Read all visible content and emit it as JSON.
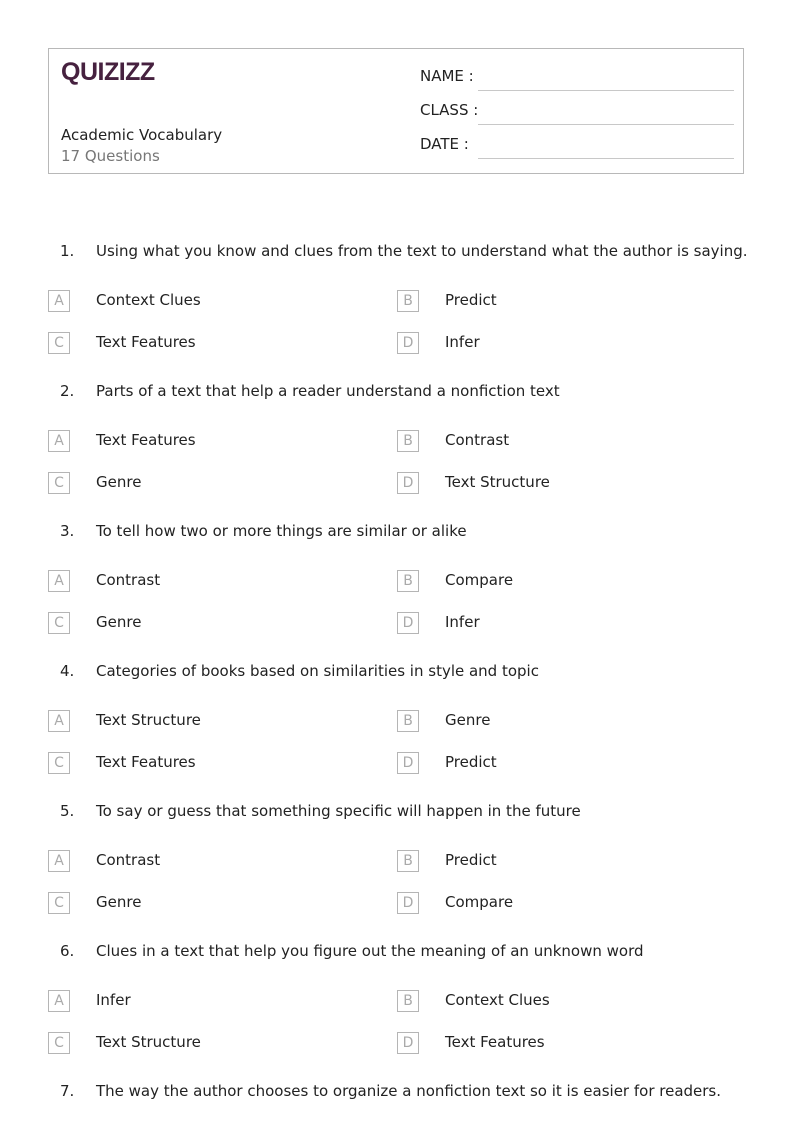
{
  "header": {
    "logo": "QUIZIZZ",
    "title": "Academic Vocabulary",
    "question_count": "17 Questions",
    "fields": [
      {
        "label": "NAME :"
      },
      {
        "label": "CLASS :"
      },
      {
        "label": "DATE  :"
      }
    ]
  },
  "questions": [
    {
      "number": "1.",
      "text": "Using what you know and clues from the text to understand what the author is saying.",
      "options": [
        {
          "letter": "A",
          "text": "Context Clues"
        },
        {
          "letter": "B",
          "text": "Predict"
        },
        {
          "letter": "C",
          "text": "Text Features"
        },
        {
          "letter": "D",
          "text": "Infer"
        }
      ]
    },
    {
      "number": "2.",
      "text": "Parts of a text that help a reader understand a nonfiction text",
      "options": [
        {
          "letter": "A",
          "text": "Text Features"
        },
        {
          "letter": "B",
          "text": "Contrast"
        },
        {
          "letter": "C",
          "text": "Genre"
        },
        {
          "letter": "D",
          "text": "Text Structure"
        }
      ]
    },
    {
      "number": "3.",
      "text": "To tell how two or more things are similar or alike",
      "options": [
        {
          "letter": "A",
          "text": "Contrast"
        },
        {
          "letter": "B",
          "text": "Compare"
        },
        {
          "letter": "C",
          "text": "Genre"
        },
        {
          "letter": "D",
          "text": "Infer"
        }
      ]
    },
    {
      "number": "4.",
      "text": "Categories of books based on similarities in style and topic",
      "options": [
        {
          "letter": "A",
          "text": "Text Structure"
        },
        {
          "letter": "B",
          "text": "Genre"
        },
        {
          "letter": "C",
          "text": "Text Features"
        },
        {
          "letter": "D",
          "text": "Predict"
        }
      ]
    },
    {
      "number": "5.",
      "text": "To say or guess that something specific will happen in the future",
      "options": [
        {
          "letter": "A",
          "text": "Contrast"
        },
        {
          "letter": "B",
          "text": "Predict"
        },
        {
          "letter": "C",
          "text": "Genre"
        },
        {
          "letter": "D",
          "text": "Compare"
        }
      ]
    },
    {
      "number": "6.",
      "text": "Clues in a text that help you figure out the meaning of an unknown word",
      "options": [
        {
          "letter": "A",
          "text": "Infer"
        },
        {
          "letter": "B",
          "text": "Context Clues"
        },
        {
          "letter": "C",
          "text": "Text Structure"
        },
        {
          "letter": "D",
          "text": "Text Features"
        }
      ]
    },
    {
      "number": "7.",
      "text": "The way the author chooses to organize a nonfiction text so it is easier for readers.",
      "options": []
    }
  ]
}
